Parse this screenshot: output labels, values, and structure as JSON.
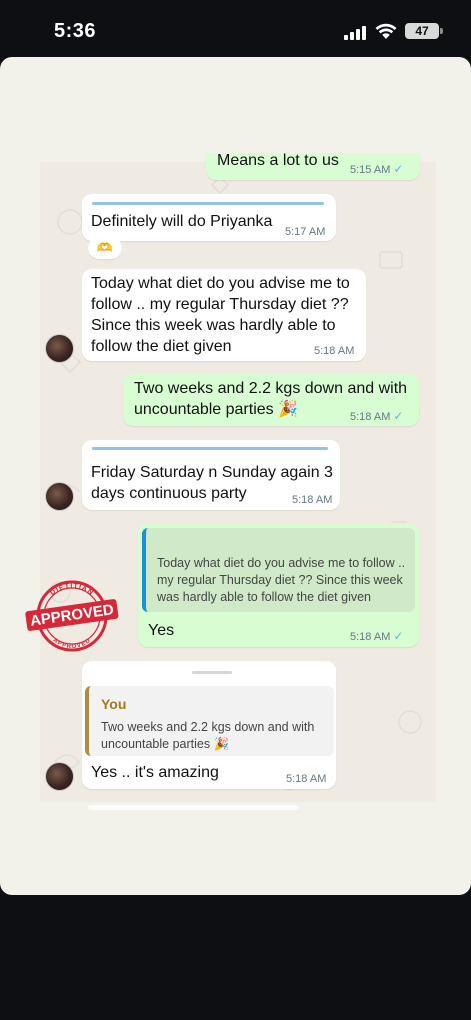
{
  "status_bar": {
    "time": "5:36",
    "battery": "47"
  },
  "messages": [
    {
      "id": "m0",
      "dir": "out",
      "text": "Means a lot to us",
      "time": "5:15 AM"
    },
    {
      "id": "m1",
      "dir": "in",
      "text": "Definitely will do Priyanka",
      "time": "5:17 AM",
      "reaction": "🫶"
    },
    {
      "id": "m2",
      "dir": "in",
      "lines": [
        "Today what diet do you advise me to",
        "follow .. my regular Thursday diet ??",
        "Since this week was hardly able to",
        "follow the diet given"
      ],
      "time": "5:18 AM"
    },
    {
      "id": "m3",
      "dir": "out",
      "lines": [
        "Two weeks and 2.2 kgs down and with",
        "uncountable parties 🎉"
      ],
      "time": "5:18 AM"
    },
    {
      "id": "m4",
      "dir": "in",
      "lines": [
        "Friday Saturday n Sunday again 3",
        "days continuous party"
      ],
      "time": "5:18 AM"
    },
    {
      "id": "m5",
      "dir": "out",
      "quote_lines": [
        "Today what diet do you advise me to follow ..",
        "my regular Thursday diet ?? Since this week",
        "was hardly able to follow the diet given"
      ],
      "text": "Yes",
      "time": "5:18 AM"
    },
    {
      "id": "m6",
      "dir": "in",
      "quote_author": "You",
      "quote_lines": [
        "Two weeks and 2.2 kgs down and with",
        "uncountable parties 🎉"
      ],
      "text": "Yes .. it's amazing",
      "time": "5:18 AM"
    }
  ],
  "stamp": {
    "word": "APPROVED",
    "ring_top": "DIETITIAN",
    "ring_bottom": "APPROVED"
  },
  "colors": {
    "incoming": "#ffffff",
    "outgoing": "#d9fdd3",
    "chat_bg": "#efeae2",
    "stamp_red": "#d62839",
    "tick": "#53bdeb"
  },
  "icons": {
    "signal": "cellular-signal-icon",
    "wifi": "wifi-icon",
    "battery": "battery-icon",
    "read": "double-check-icon"
  }
}
